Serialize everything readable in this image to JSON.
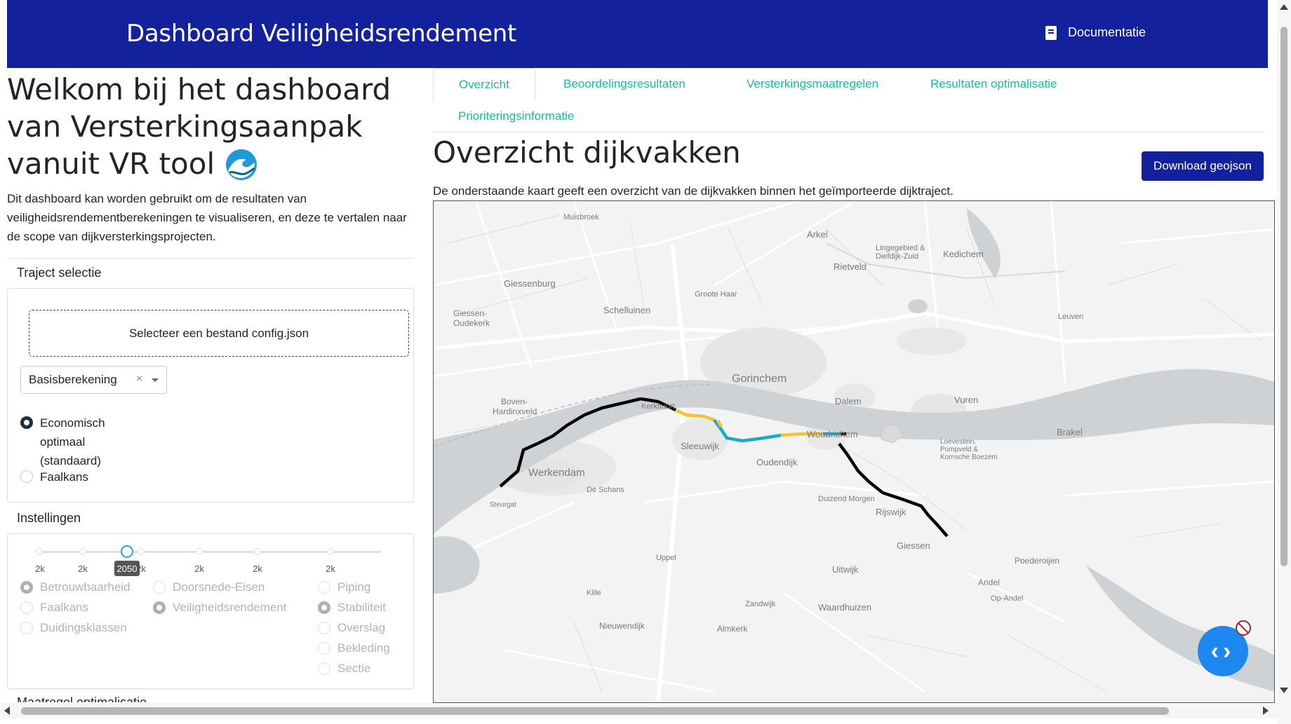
{
  "header": {
    "title": "Dashboard Veiligheidsrendement",
    "docs_label": "Documentatie",
    "docs_icon": "book-icon",
    "bg_color": "#13219c"
  },
  "sidebar": {
    "welcome": "Welkom bij het dashboard van Versterkingsaanpak vanuit VR tool",
    "welcome_icon": "wave-icon",
    "intro": "Dit dashboard kan worden gebruikt om de resultaten van veiligheidsrendementberekeningen te visualiseren, en deze te vertalen naar de scope van dijkversterkingsprojecten.",
    "traject": {
      "title": "Traject selectie",
      "upload_label": "Selecteer een bestand config.json",
      "select_value": "Basisberekening",
      "select_clear": "×",
      "radio_options": [
        {
          "label": "Economisch optimaal (standaard)",
          "checked": true
        },
        {
          "label": "Faalkans",
          "checked": false
        }
      ]
    },
    "settings": {
      "title": "Instellingen",
      "slider_ticks": [
        "2k",
        "2k",
        "2k",
        "2k",
        "2k",
        "2k"
      ],
      "slider_value": "2050",
      "col1": [
        {
          "label": "Betrouwbaarheid",
          "checked": true
        },
        {
          "label": "Faalkans",
          "checked": false
        },
        {
          "label": "Duidingsklassen",
          "checked": false
        }
      ],
      "col2": [
        {
          "label": "Doorsnede-Eisen",
          "checked": false
        },
        {
          "label": "Veiligheidsrendement",
          "checked": true
        }
      ],
      "col3": [
        {
          "label": "Piping",
          "checked": false
        },
        {
          "label": "Stabiliteit",
          "checked": true
        },
        {
          "label": "Overslag",
          "checked": false
        },
        {
          "label": "Bekleding",
          "checked": false
        },
        {
          "label": "Sectie",
          "checked": false
        }
      ]
    },
    "cut_section_title": "Maatregel optimalisatie"
  },
  "main": {
    "tabs": [
      {
        "label": "Overzicht",
        "active": true
      },
      {
        "label": "Beoordelingsresultaten",
        "active": false
      },
      {
        "label": "Versterkingsmaatregelen",
        "active": false
      },
      {
        "label": "Resultaten optimalisatie",
        "active": false
      },
      {
        "label": "Prioriteringsinformatie",
        "active": false
      }
    ],
    "page_title": "Overzicht dijkvakken",
    "download_label": "Download geojson",
    "description": "De onderstaande kaart geeft een overzicht van de dijkvakken binnen het geïmporteerde dijktraject.",
    "map_labels": {
      "muisbroek": "Muisbroek",
      "arkel": "Arkel",
      "lingegebied": "Lingegebied &",
      "diefdijk": "Diefdijk-Zuid",
      "kedichem": "Kedichem",
      "rietveld": "Rietveld",
      "giessenburg": "Giessenburg",
      "groote_haar": "Groote Haar",
      "schelluinen": "Schelluinen",
      "giessen_oudekerk": "Giessen-",
      "oudekerk": "Oudekerk",
      "leuven": "Leuven",
      "gorinchem": "Gorinchem",
      "dalem": "Dalem",
      "vuren": "Vuren",
      "boven_hardinxveld": "Boven-",
      "hardinxveld": "Hardinxveld",
      "kerkbuurt": "Kerkbuurt",
      "sleeuwijk": "Sleeuwijk",
      "woudrichem": "Woudrichem",
      "loevestein": "Loevestein,",
      "pompveld": "Pompveld &",
      "kornsche": "Kornsche Boezem",
      "brakel": "Brakel",
      "werkendam": "Werkendam",
      "de_schans": "De Schans",
      "oudendijk": "Oudendijk",
      "duizend_morgen": "Duizend Morgen",
      "rijswijk": "Rijswijk",
      "giessen": "Giessen",
      "steurgat": "Steurgat",
      "uppel": "Uppel",
      "uitwijk": "Uitwijk",
      "poederoijen": "Poederoijen",
      "andel": "Andel",
      "op_andel": "Op-Andel",
      "kille": "Kille",
      "zandwijk": "Zandwijk",
      "waardhuizen": "Waardhuizen",
      "nieuwendijk": "Nieuwendijk",
      "almkerk": "Almkerk"
    },
    "segment_colors": {
      "black": "#000000",
      "yellow": "#f2c230",
      "cyan": "#19a9c6"
    }
  },
  "fab": {
    "icon": "code-brackets-icon",
    "badge_icon": "ban-icon",
    "color": "#1e88f0"
  }
}
